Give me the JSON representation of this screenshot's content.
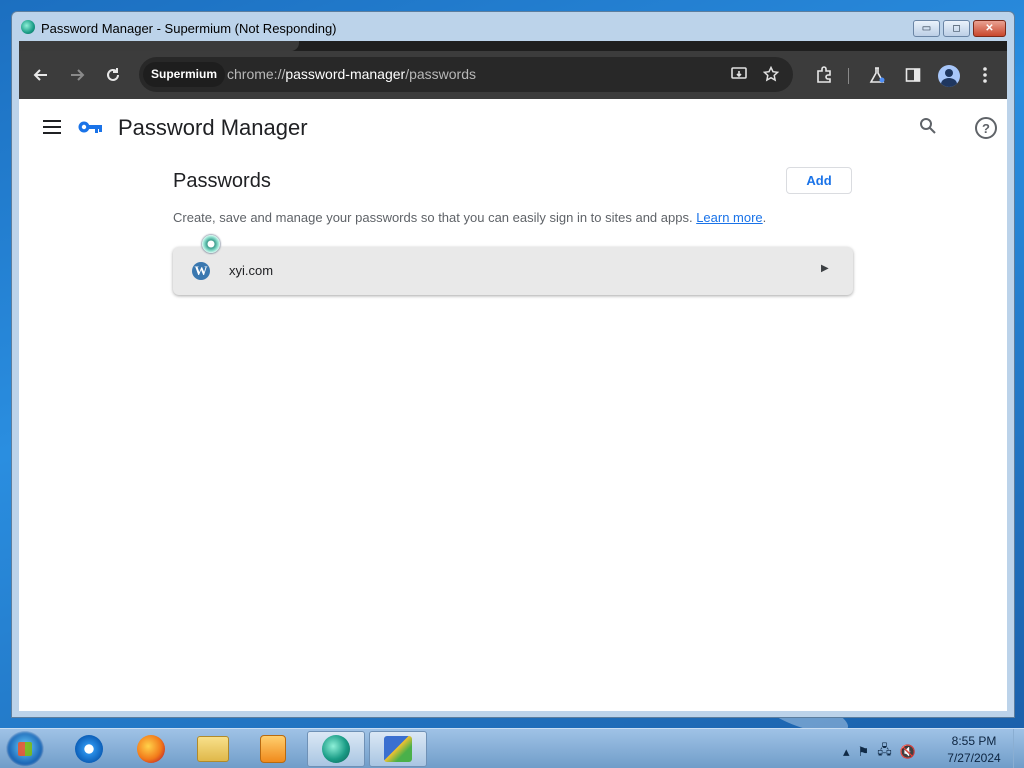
{
  "window": {
    "title": "Password Manager - Supermium (Not Responding)",
    "controls": {
      "minimize": "▭",
      "maximize": "◻",
      "close": "✕"
    }
  },
  "browser": {
    "chip_label": "Supermium",
    "url_scheme": "chrome://",
    "url_host": "password-manager",
    "url_path": "/passwords",
    "icons": [
      "back-arrow-icon",
      "forward-arrow-icon",
      "reload-icon",
      "install-app-icon",
      "bookmark-star-icon",
      "extensions-icon",
      "labs-flask-icon",
      "side-panel-icon",
      "profile-avatar-icon",
      "menu-dots-icon"
    ]
  },
  "page": {
    "app_title": "Password Manager",
    "section_title": "Passwords",
    "add_label": "Add",
    "description": "Create, save and manage your passwords so that you can easily sign in to sites and apps. ",
    "learn_more": "Learn more",
    "description_end": ".",
    "entries": [
      {
        "site": "xyi.com",
        "icon": "wordpress-icon"
      }
    ]
  },
  "taskbar": {
    "apps": [
      "internet-explorer-icon",
      "firefox-icon",
      "file-explorer-icon",
      "media-player-icon",
      "supermium-icon",
      "task-app-icon"
    ],
    "time": "8:55 PM",
    "date": "7/27/2024"
  },
  "colors": {
    "accent": "#1a73e8",
    "toolbar": "#3c3c3c",
    "titlebar": "#bcd3ea"
  }
}
